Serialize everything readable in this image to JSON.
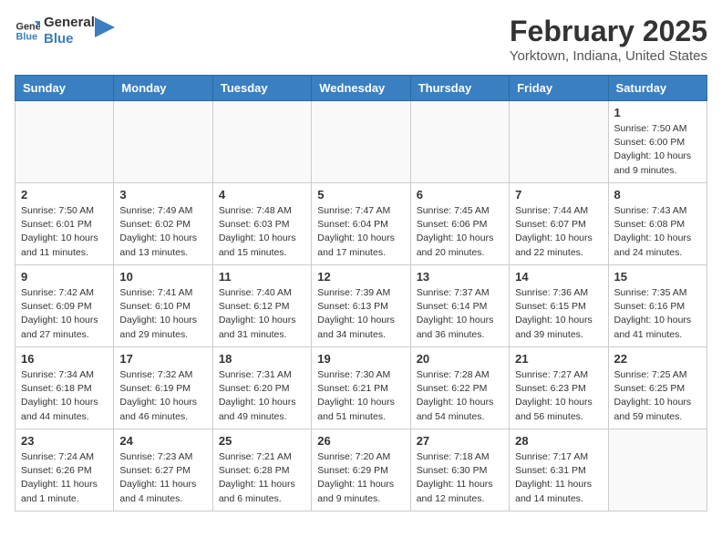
{
  "header": {
    "logo_line1": "General",
    "logo_line2": "Blue",
    "month": "February 2025",
    "location": "Yorktown, Indiana, United States"
  },
  "weekdays": [
    "Sunday",
    "Monday",
    "Tuesday",
    "Wednesday",
    "Thursday",
    "Friday",
    "Saturday"
  ],
  "weeks": [
    [
      {
        "day": "",
        "info": ""
      },
      {
        "day": "",
        "info": ""
      },
      {
        "day": "",
        "info": ""
      },
      {
        "day": "",
        "info": ""
      },
      {
        "day": "",
        "info": ""
      },
      {
        "day": "",
        "info": ""
      },
      {
        "day": "1",
        "info": "Sunrise: 7:50 AM\nSunset: 6:00 PM\nDaylight: 10 hours and 9 minutes."
      }
    ],
    [
      {
        "day": "2",
        "info": "Sunrise: 7:50 AM\nSunset: 6:01 PM\nDaylight: 10 hours and 11 minutes."
      },
      {
        "day": "3",
        "info": "Sunrise: 7:49 AM\nSunset: 6:02 PM\nDaylight: 10 hours and 13 minutes."
      },
      {
        "day": "4",
        "info": "Sunrise: 7:48 AM\nSunset: 6:03 PM\nDaylight: 10 hours and 15 minutes."
      },
      {
        "day": "5",
        "info": "Sunrise: 7:47 AM\nSunset: 6:04 PM\nDaylight: 10 hours and 17 minutes."
      },
      {
        "day": "6",
        "info": "Sunrise: 7:45 AM\nSunset: 6:06 PM\nDaylight: 10 hours and 20 minutes."
      },
      {
        "day": "7",
        "info": "Sunrise: 7:44 AM\nSunset: 6:07 PM\nDaylight: 10 hours and 22 minutes."
      },
      {
        "day": "8",
        "info": "Sunrise: 7:43 AM\nSunset: 6:08 PM\nDaylight: 10 hours and 24 minutes."
      }
    ],
    [
      {
        "day": "9",
        "info": "Sunrise: 7:42 AM\nSunset: 6:09 PM\nDaylight: 10 hours and 27 minutes."
      },
      {
        "day": "10",
        "info": "Sunrise: 7:41 AM\nSunset: 6:10 PM\nDaylight: 10 hours and 29 minutes."
      },
      {
        "day": "11",
        "info": "Sunrise: 7:40 AM\nSunset: 6:12 PM\nDaylight: 10 hours and 31 minutes."
      },
      {
        "day": "12",
        "info": "Sunrise: 7:39 AM\nSunset: 6:13 PM\nDaylight: 10 hours and 34 minutes."
      },
      {
        "day": "13",
        "info": "Sunrise: 7:37 AM\nSunset: 6:14 PM\nDaylight: 10 hours and 36 minutes."
      },
      {
        "day": "14",
        "info": "Sunrise: 7:36 AM\nSunset: 6:15 PM\nDaylight: 10 hours and 39 minutes."
      },
      {
        "day": "15",
        "info": "Sunrise: 7:35 AM\nSunset: 6:16 PM\nDaylight: 10 hours and 41 minutes."
      }
    ],
    [
      {
        "day": "16",
        "info": "Sunrise: 7:34 AM\nSunset: 6:18 PM\nDaylight: 10 hours and 44 minutes."
      },
      {
        "day": "17",
        "info": "Sunrise: 7:32 AM\nSunset: 6:19 PM\nDaylight: 10 hours and 46 minutes."
      },
      {
        "day": "18",
        "info": "Sunrise: 7:31 AM\nSunset: 6:20 PM\nDaylight: 10 hours and 49 minutes."
      },
      {
        "day": "19",
        "info": "Sunrise: 7:30 AM\nSunset: 6:21 PM\nDaylight: 10 hours and 51 minutes."
      },
      {
        "day": "20",
        "info": "Sunrise: 7:28 AM\nSunset: 6:22 PM\nDaylight: 10 hours and 54 minutes."
      },
      {
        "day": "21",
        "info": "Sunrise: 7:27 AM\nSunset: 6:23 PM\nDaylight: 10 hours and 56 minutes."
      },
      {
        "day": "22",
        "info": "Sunrise: 7:25 AM\nSunset: 6:25 PM\nDaylight: 10 hours and 59 minutes."
      }
    ],
    [
      {
        "day": "23",
        "info": "Sunrise: 7:24 AM\nSunset: 6:26 PM\nDaylight: 11 hours and 1 minute."
      },
      {
        "day": "24",
        "info": "Sunrise: 7:23 AM\nSunset: 6:27 PM\nDaylight: 11 hours and 4 minutes."
      },
      {
        "day": "25",
        "info": "Sunrise: 7:21 AM\nSunset: 6:28 PM\nDaylight: 11 hours and 6 minutes."
      },
      {
        "day": "26",
        "info": "Sunrise: 7:20 AM\nSunset: 6:29 PM\nDaylight: 11 hours and 9 minutes."
      },
      {
        "day": "27",
        "info": "Sunrise: 7:18 AM\nSunset: 6:30 PM\nDaylight: 11 hours and 12 minutes."
      },
      {
        "day": "28",
        "info": "Sunrise: 7:17 AM\nSunset: 6:31 PM\nDaylight: 11 hours and 14 minutes."
      },
      {
        "day": "",
        "info": ""
      }
    ]
  ]
}
